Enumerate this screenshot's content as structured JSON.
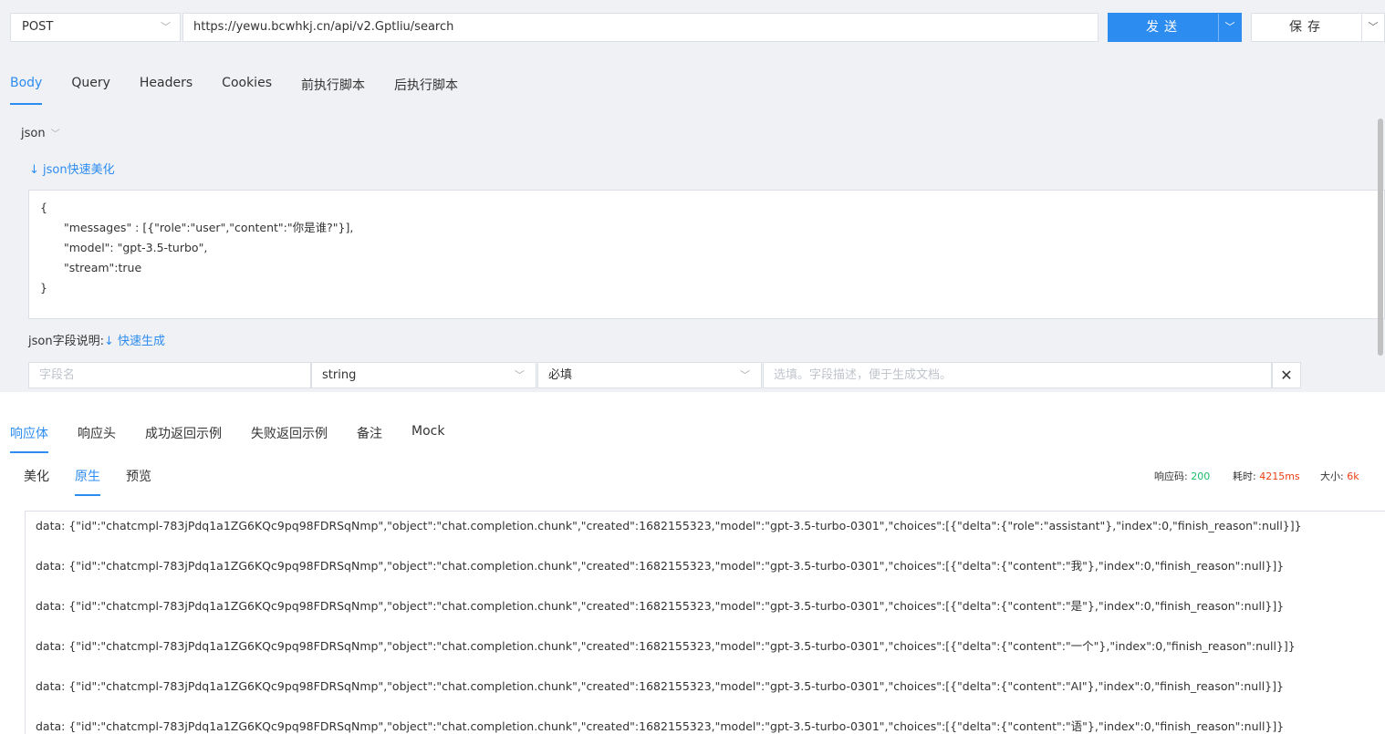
{
  "request": {
    "method": "POST",
    "url": "https://yewu.bcwhkj.cn/api/v2.Gptliu/search",
    "send_label": "发送",
    "save_label": "保存"
  },
  "request_tabs": [
    "Body",
    "Query",
    "Headers",
    "Cookies",
    "前执行脚本",
    "后执行脚本"
  ],
  "body": {
    "format": "json",
    "beautify_label": "json快速美化",
    "lines": [
      "{",
      "\"messages\" : [{\"role\":\"user\",\"content\":\"你是谁?\"}],",
      "\"model\": \"gpt-3.5-turbo\",",
      "\"stream\":true",
      "}"
    ],
    "field_desc_label": "json字段说明:",
    "quick_gen_label": "快速生成",
    "field_row": {
      "name_placeholder": "字段名",
      "type": "string",
      "required": "必填",
      "desc_placeholder": "选填。字段描述，便于生成文档。"
    }
  },
  "response_tabs": [
    "响应体",
    "响应头",
    "成功返回示例",
    "失败返回示例",
    "备注",
    "Mock"
  ],
  "view_tabs": [
    "美化",
    "原生",
    "预览"
  ],
  "stats": {
    "code_label": "响应码:",
    "code": "200",
    "time_label": "耗时:",
    "time": "4215ms",
    "size_label": "大小:",
    "size": "6k"
  },
  "response_lines": [
    "data: {\"id\":\"chatcmpl-783jPdq1a1ZG6KQc9pq98FDRSqNmp\",\"object\":\"chat.completion.chunk\",\"created\":1682155323,\"model\":\"gpt-3.5-turbo-0301\",\"choices\":[{\"delta\":{\"role\":\"assistant\"},\"index\":0,\"finish_reason\":null}]}",
    "data: {\"id\":\"chatcmpl-783jPdq1a1ZG6KQc9pq98FDRSqNmp\",\"object\":\"chat.completion.chunk\",\"created\":1682155323,\"model\":\"gpt-3.5-turbo-0301\",\"choices\":[{\"delta\":{\"content\":\"我\"},\"index\":0,\"finish_reason\":null}]}",
    "data: {\"id\":\"chatcmpl-783jPdq1a1ZG6KQc9pq98FDRSqNmp\",\"object\":\"chat.completion.chunk\",\"created\":1682155323,\"model\":\"gpt-3.5-turbo-0301\",\"choices\":[{\"delta\":{\"content\":\"是\"},\"index\":0,\"finish_reason\":null}]}",
    "data: {\"id\":\"chatcmpl-783jPdq1a1ZG6KQc9pq98FDRSqNmp\",\"object\":\"chat.completion.chunk\",\"created\":1682155323,\"model\":\"gpt-3.5-turbo-0301\",\"choices\":[{\"delta\":{\"content\":\"一个\"},\"index\":0,\"finish_reason\":null}]}",
    "data: {\"id\":\"chatcmpl-783jPdq1a1ZG6KQc9pq98FDRSqNmp\",\"object\":\"chat.completion.chunk\",\"created\":1682155323,\"model\":\"gpt-3.5-turbo-0301\",\"choices\":[{\"delta\":{\"content\":\"AI\"},\"index\":0,\"finish_reason\":null}]}",
    "data: {\"id\":\"chatcmpl-783jPdq1a1ZG6KQc9pq98FDRSqNmp\",\"object\":\"chat.completion.chunk\",\"created\":1682155323,\"model\":\"gpt-3.5-turbo-0301\",\"choices\":[{\"delta\":{\"content\":\"语\"},\"index\":0,\"finish_reason\":null}]}"
  ],
  "colors": {
    "accent": "#2d8cf0",
    "success": "#19be6b",
    "danger": "#ed4014"
  }
}
